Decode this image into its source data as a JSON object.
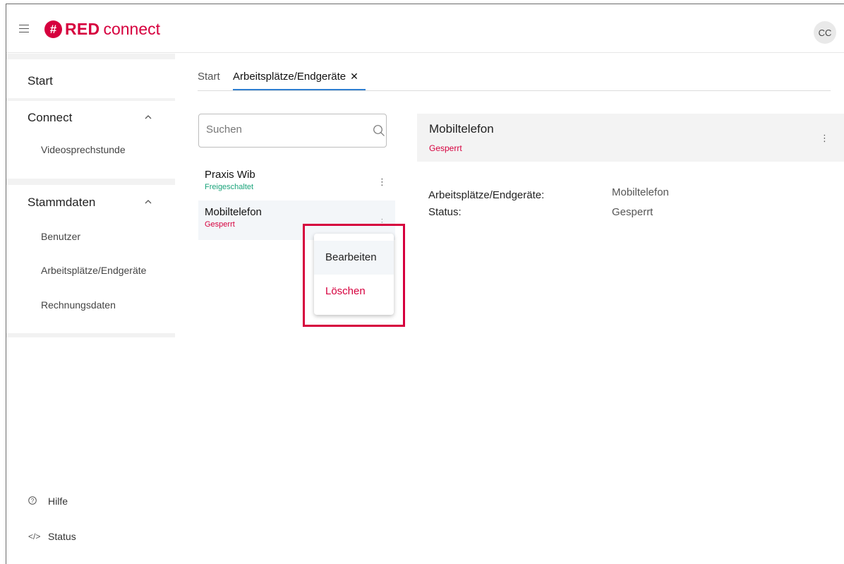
{
  "header": {
    "logo_mark": "#",
    "logo_red": "RED",
    "logo_connect": "connect",
    "avatar_initials": "CC",
    "brand_color": "#d6003e"
  },
  "sidebar": {
    "start": "Start",
    "connect": {
      "title": "Connect",
      "items": [
        "Videosprechstunde"
      ]
    },
    "stammdaten": {
      "title": "Stammdaten",
      "items": [
        "Benutzer",
        "Arbeitsplätze/Endgeräte",
        "Rechnungsdaten"
      ]
    },
    "footer": [
      {
        "label": "Hilfe",
        "icon": "help-icon"
      },
      {
        "label": "Status",
        "icon": "code-icon"
      }
    ]
  },
  "tabs": {
    "start": "Start",
    "active": "Arbeitsplätze/Endgeräte",
    "close_glyph": "✕"
  },
  "search": {
    "placeholder": "Suchen",
    "value": ""
  },
  "list": [
    {
      "name": "Praxis Wib",
      "status": "Freigeschaltet",
      "status_color": "#1aa37a"
    },
    {
      "name": "Mobiltelefon",
      "status": "Gesperrt",
      "status_color": "#d6003e"
    }
  ],
  "context_menu": {
    "edit": "Bearbeiten",
    "delete": "Löschen",
    "delete_color": "#d6003e"
  },
  "detail": {
    "title": "Mobiltelefon",
    "status": "Gesperrt",
    "fields": [
      {
        "label": "Arbeitsplätze/Endgeräte:",
        "value": "Mobiltelefon"
      },
      {
        "label": "Status:",
        "value": "Gesperrt"
      }
    ]
  }
}
